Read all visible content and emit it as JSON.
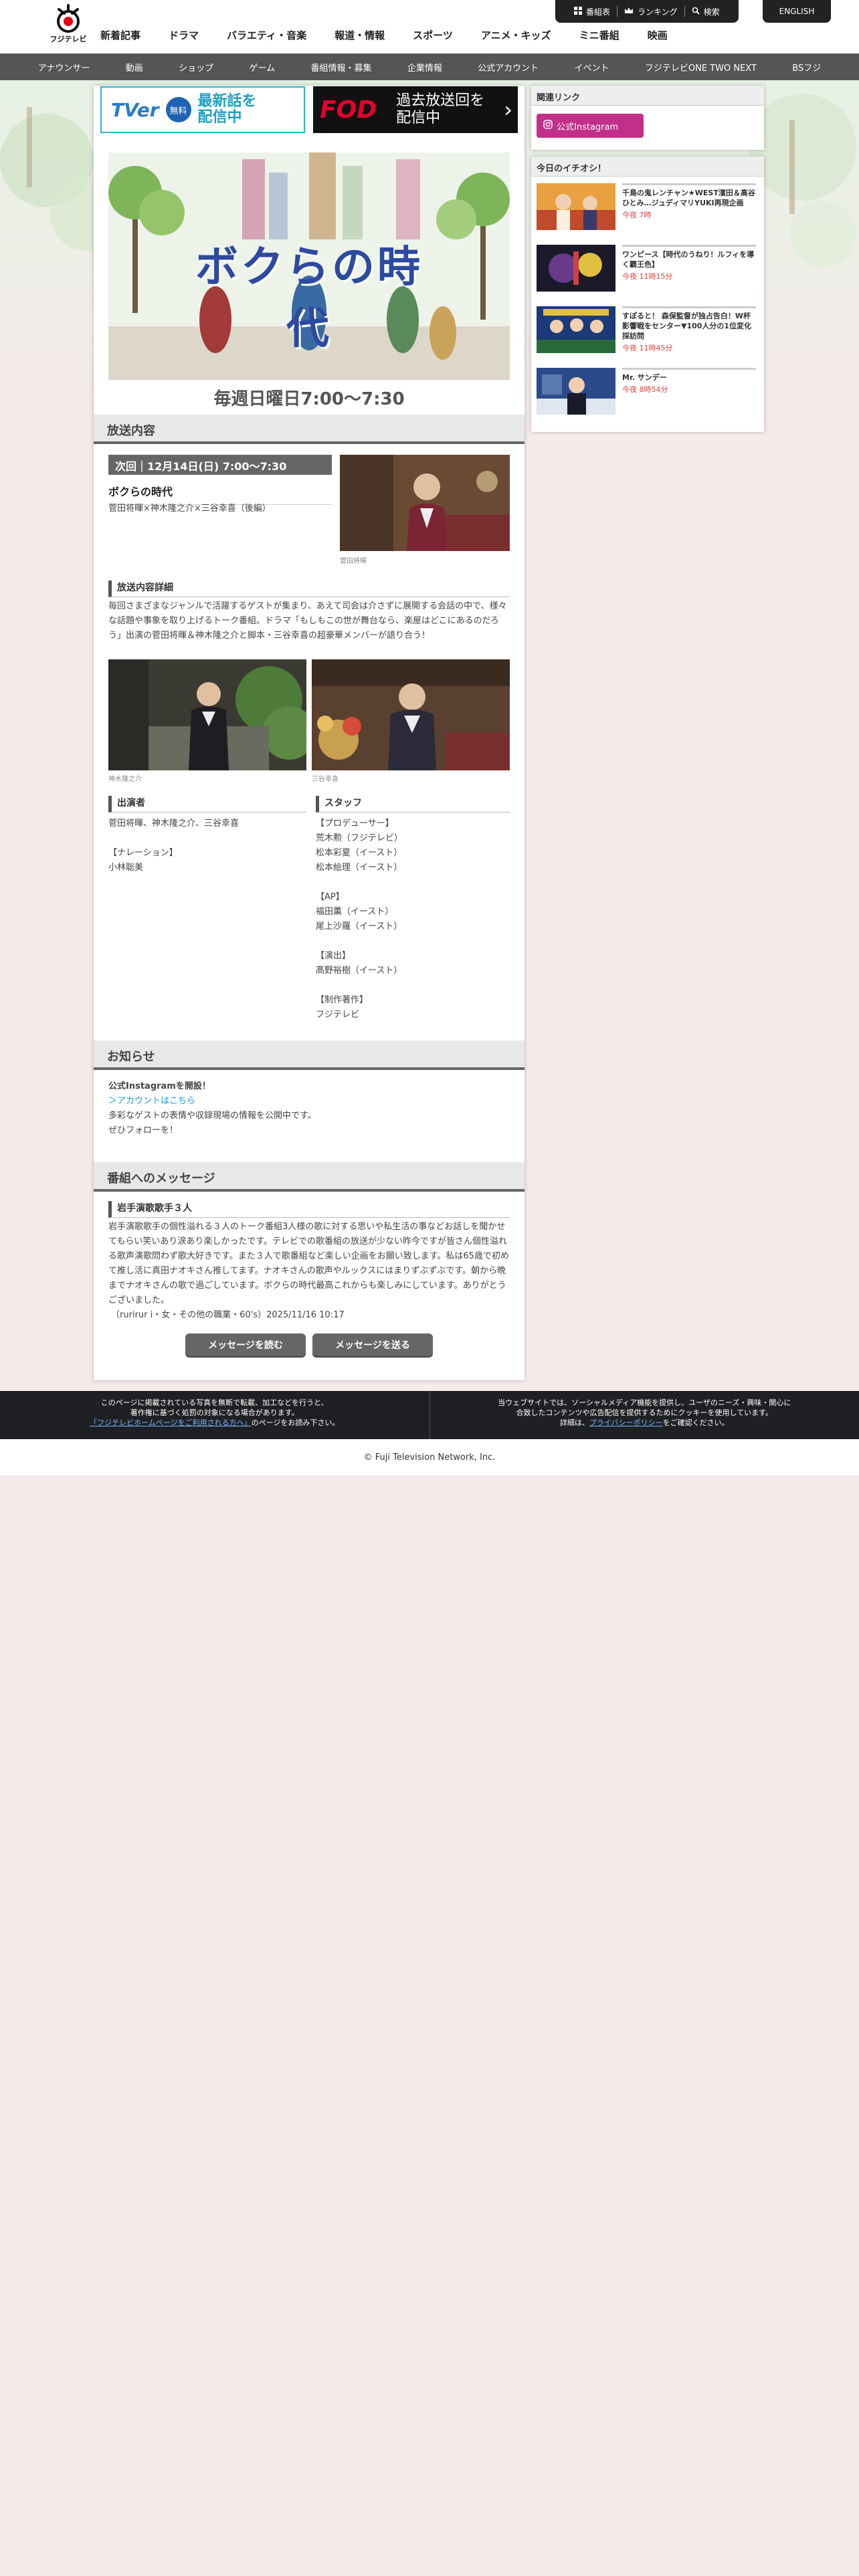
{
  "header": {
    "logo_text": "フジテレビ",
    "main_nav": [
      "新着記事",
      "ドラマ",
      "バラエティ・音楽",
      "報道・情報",
      "スポーツ",
      "アニメ・キッズ",
      "ミニ番組",
      "映画"
    ],
    "toolbar": {
      "schedule": "番組表",
      "ranking": "ランキング",
      "search": "検索"
    },
    "english": "ENGLISH"
  },
  "subnav": [
    "アナウンサー",
    "動画",
    "ショップ",
    "ゲーム",
    "番組情報・募集",
    "企業情報",
    "公式アカウント",
    "イベント",
    "フジテレビONE TWO NEXT",
    "BSフジ"
  ],
  "banners": {
    "tver_logo": "TVer",
    "tver_free": "無料",
    "tver_text_1": "最新話を",
    "tver_text_2": "配信中",
    "fod_logo": "FOD",
    "fod_text_1": "過去放送回を",
    "fod_text_2": "配信中"
  },
  "program": {
    "logo_title": "ボクらの時代",
    "schedule": "毎週日曜日7:00〜7:30"
  },
  "broadcast": {
    "section_title": "放送内容",
    "next_badge": "次回｜12月14日(日) 7:00〜7:30",
    "title": "ボクらの時代",
    "cast_line": "菅田将暉×神木隆之介×三谷幸喜（後編）",
    "photo1_caption": "菅田将暉",
    "detail_heading": "放送内容詳細",
    "detail_text": "毎回さまざまなジャンルで活躍するゲストが集まり、あえて司会は介さずに展開する会話の中で、様々な話題や事象を取り上げるトーク番組。ドラマ「もしもこの世が舞台なら、楽屋はどこにあるのだろう」出演の菅田将暉＆神木隆之介と脚本・三谷幸喜の超豪華メンバーが語り合う！",
    "photo2_caption": "神木隆之介",
    "photo3_caption": "三谷幸喜",
    "cast_heading": "出演者",
    "cast_text": "菅田将暉、神木隆之介、三谷幸喜\n\n【ナレーション】\n小林聡美",
    "staff_heading": "スタッフ",
    "staff_text": "【プロデューサー】\n荒木勲（フジテレビ）\n松本彩夏（イースト）\n松本絵理（イースト）\n\n【AP】\n福田薫（イースト）\n尾上沙羅（イースト）\n\n【演出】\n髙野裕樹（イースト）\n\n【制作著作】\nフジテレビ"
  },
  "news": {
    "section_title": "お知らせ",
    "headline": "公式Instagramを開設！",
    "link": "＞アカウントはこちら",
    "line1": "多彩なゲストの表情や収録現場の情報を公開中です。",
    "line2": "ぜひフォローを！"
  },
  "messages": {
    "section_title": "番組へのメッセージ",
    "heading": "岩手演歌歌手３人",
    "body": "岩手演歌歌手の個性溢れる３人のトーク番組3人様の歌に対する思いや私生活の事などお話しを聞かせてもらい笑いあり涙あり楽しかったです。テレビでの歌番組の放送が少ない昨今ですが皆さん個性溢れる歌声演歌問わず歌大好きです。また３人で歌番組など楽しい企画をお願い致します。私は65歳で初めて推し活に真田ナオキさん推してます。ナオキさんの歌声やルックスにはまりずぶずぶです。朝から晩までナオキさんの歌で過ごしています。ボクらの時代最高これからも楽しみにしています。ありがとうございました。",
    "signature": "（rurirur i・女・その他の職業・60's）2025/11/16 10:17",
    "read_button": "メッセージを読む",
    "send_button": "メッセージを送る"
  },
  "sidebar": {
    "related_title": "関連リンク",
    "instagram_label": "公式Instagram",
    "picks_title": "今日のイチオシ！",
    "picks": [
      {
        "title": "千鳥の鬼レンチャン★WEST濱田＆高谷ひとみ…ジュディマリYUKI再現企画",
        "time": "今夜 7時"
      },
      {
        "title": "ワンピース【時代のうねり！ルフィを導く覇王色】",
        "time": "今夜 11時15分"
      },
      {
        "title": "すぽると！ 森保監督が独占告白！W杯影響戦をセンター▼100人分の1位変化採訪問",
        "time": "今夜 11時45分"
      },
      {
        "title": "Mr. サンデー",
        "time": "今夜 8時54分"
      }
    ]
  },
  "footer": {
    "left_line1": "このページに掲載されている写真を無断で転載、加工などを行うと、",
    "left_line2": "著作権に基づく処罰の対象になる場合があります。",
    "left_link": "「フジテレビホームページをご利用される方へ」",
    "left_line3": "のページをお読み下さい。",
    "right_line1": "当ウェブサイトでは、ソーシャルメディア機能を提供し、ユーザのニーズ・興味・関心に",
    "right_line2": "合致したコンテンツや広告配信を提供するためにクッキーを使用しています。",
    "right_line3_a": "詳細は、",
    "right_link": "プライバシーポリシー",
    "right_line3_b": "をご確認ください。",
    "copyright": "© Fuji Television Network, Inc."
  }
}
